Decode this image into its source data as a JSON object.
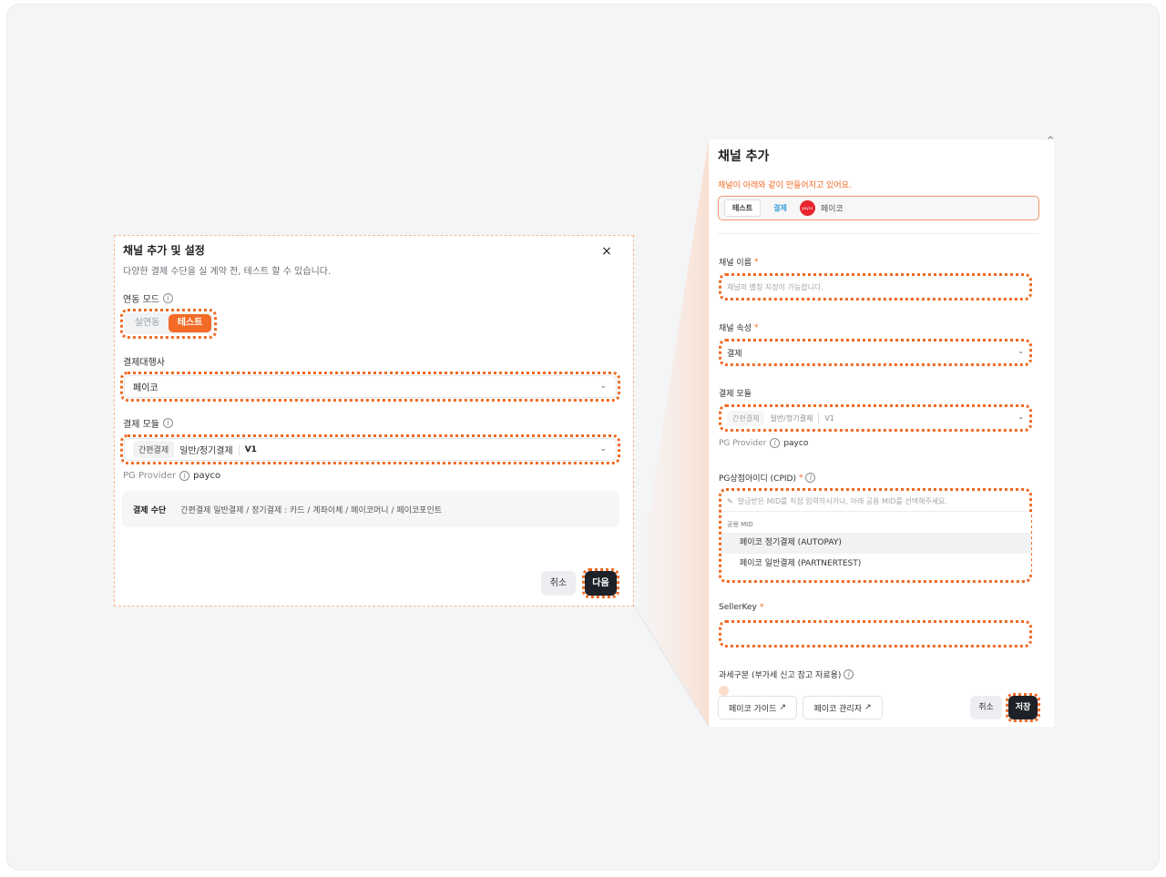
{
  "left_modal": {
    "title": "채널 추가 및 설정",
    "subtitle": "다양한 결제 수단을 실 계약 전, 테스트 할 수 있습니다.",
    "close_icon": "×",
    "mode_label": "연동 모드",
    "mode_options": [
      "실연동",
      "테스트"
    ],
    "mode_selected": "테스트",
    "pg_label": "결제대행사",
    "pg_value": "페이코",
    "module_label": "결제 모듈",
    "module_tag": "간편결제",
    "module_type": "일반/정기결제",
    "module_version": "V1",
    "provider_label": "PG Provider",
    "provider_value": "payco",
    "pay_method_label": "결제 수단",
    "pay_method_value": "간편결제 일반결제 / 정기결제 : 카드 / 계좌이체 / 페이코머니 / 페이코포인트",
    "cancel": "취소",
    "next": "다음"
  },
  "right_panel": {
    "title": "채널 추가",
    "notice": "채널이 아래와 같이 만들어지고 있어요.",
    "preview_mode": "테스트",
    "preview_type": "결제",
    "preview_logo_text": "payco",
    "preview_pg": "페이코",
    "name_label": "채널 이름",
    "name_placeholder": "채널의 별칭 지정이 가능합니다.",
    "attr_label": "채널 속성",
    "attr_value": "결제",
    "module_label": "결제 모듈",
    "module_tag": "간편결제",
    "module_type": "일반/정기결제",
    "module_version": "V1",
    "provider_label": "PG Provider",
    "provider_value": "payco",
    "cpid_label": "PG상점아이디 (CPID)",
    "cpid_placeholder": "발급받은 MID를 직접 입력하시거나, 아래 공용 MID를 선택해주세요.",
    "mid_group": "공용 MID",
    "mid_options": [
      "페이코 정기결제 (AUTOPAY)",
      "페이코 일반결제 (PARTNERTEST)"
    ],
    "sellerkey_label": "SellerKey",
    "tax_label": "과세구분 (부가세 신고 참고 자료용)",
    "guide_button": "페이코 가이드",
    "admin_button": "페이코 관리자",
    "cancel": "취소",
    "save": "저장",
    "required_mark": "*",
    "external_icon": "↗"
  },
  "colors": {
    "accent": "#f06a23",
    "dark_button": "#1e2128",
    "frame_bg": "#f4f5f7"
  }
}
